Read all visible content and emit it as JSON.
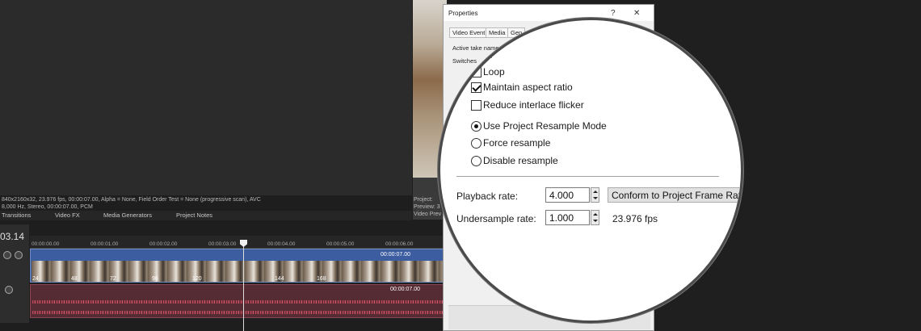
{
  "background": {
    "info_lines": [
      "840x2160x32, 23.976 fps, 00:00:07.00, Alpha = None, Field Order Test = None (progressive scan), AVC",
      "8,000 Hz, Stereo, 00:00:07.00, PCM"
    ],
    "tabs": [
      "Transitions",
      "Video FX",
      "Media Generators",
      "Project Notes"
    ],
    "preview_lines": [
      "Project: ",
      "Preview: 3",
      "Video Prev"
    ],
    "timecode": "03.14",
    "ruler_labels": [
      "00:00:00.00",
      "00:00:01.00",
      "00:00:02.00",
      "00:00:03.00",
      "00:00:04.00",
      "00:00:05.00",
      "00:00:06.00"
    ],
    "video_clip_time": "00:00:07.00",
    "audio_clip_time": "00:00:07.00",
    "frame_numbers": [
      "24",
      "48",
      "72",
      "96",
      "120",
      "144",
      "168"
    ]
  },
  "dialog": {
    "title": "Properties",
    "help": "?",
    "close": "✕",
    "tabs": [
      "Video Event",
      "Media",
      "Gen"
    ],
    "active_take_label": "Active take name",
    "switches_label": "Switches"
  },
  "magnified": {
    "partial_top": "k",
    "switches": [
      {
        "label": "Loop",
        "checked": false
      },
      {
        "label": "Maintain aspect ratio",
        "checked": true
      },
      {
        "label": "Reduce interlace flicker",
        "checked": false
      }
    ],
    "resample": [
      {
        "label": "Use Project Resample Mode",
        "checked": true
      },
      {
        "label": "Force resample",
        "checked": false
      },
      {
        "label": "Disable resample",
        "checked": false
      }
    ],
    "playback_rate_label": "Playback rate:",
    "playback_rate_value": "4.000",
    "conform_button": "Conform to Project Frame Rate",
    "undersample_rate_label": "Undersample rate:",
    "undersample_rate_value": "1.000",
    "fps_text": "23.976 fps"
  }
}
